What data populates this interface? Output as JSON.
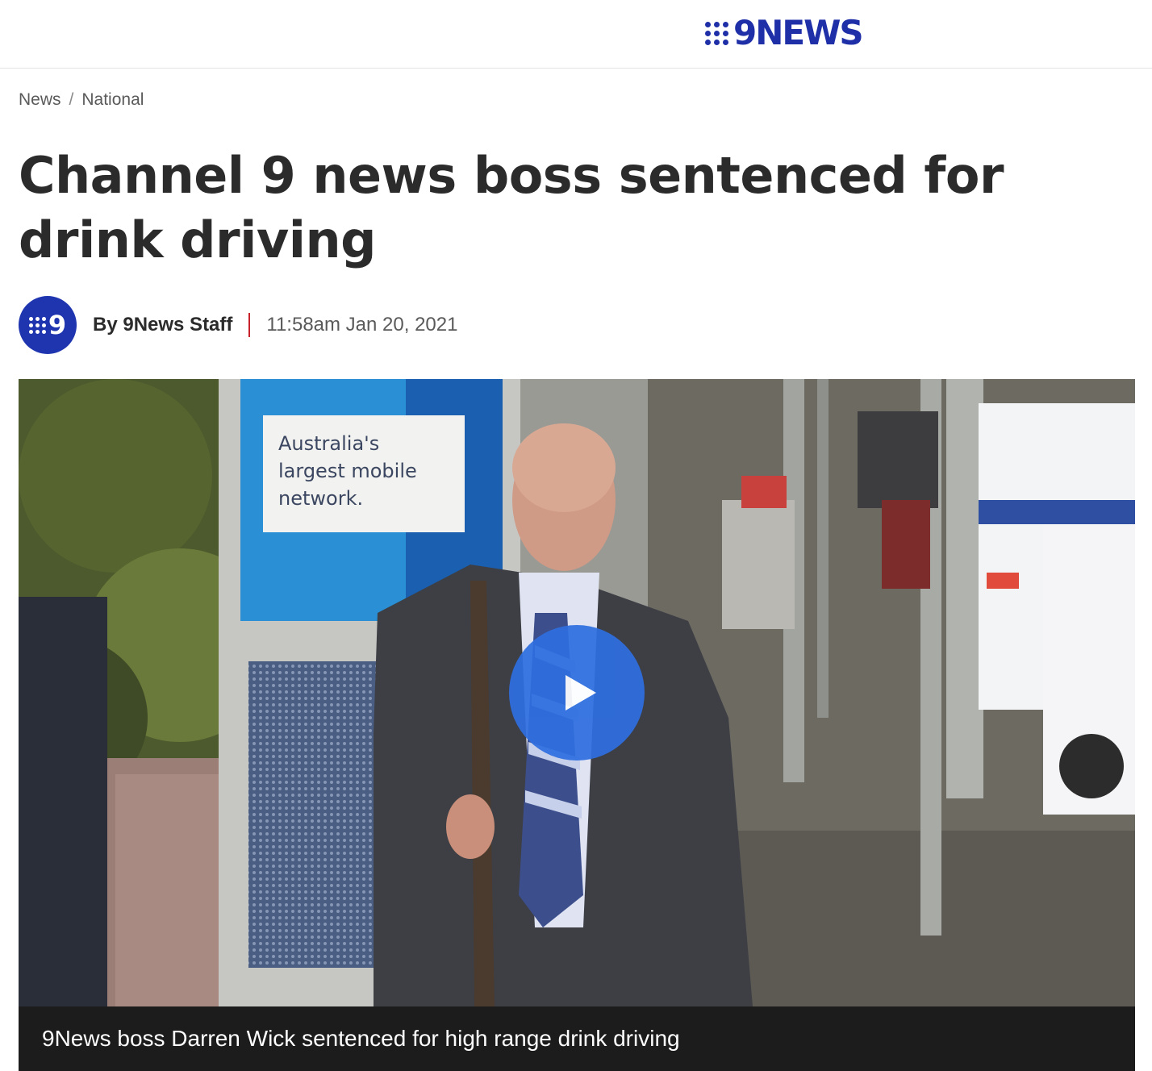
{
  "header": {
    "brand_label": "9NEWS",
    "brand_icon": "nine-dots-logo"
  },
  "breadcrumb": {
    "items": [
      "News",
      "National"
    ],
    "separator": "/"
  },
  "article": {
    "title": "Channel 9 news boss sentenced for drink driving",
    "author_avatar_label": "9",
    "author": "By 9News Staff",
    "timestamp": "11:58am Jan 20, 2021"
  },
  "video": {
    "sign_lines": [
      "Australia's",
      "largest mobile",
      "network."
    ],
    "caption": "9News boss Darren Wick sentenced for high range drink driving",
    "play_icon": "play-icon"
  },
  "colors": {
    "brand_blue": "#1f2fa8",
    "play_blue": "#2f6fe0",
    "divider_red": "#c8232c",
    "caption_bg": "#1c1c1c"
  }
}
